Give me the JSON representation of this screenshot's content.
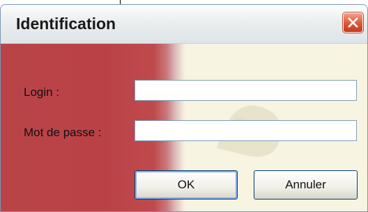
{
  "window": {
    "title": "Identification"
  },
  "form": {
    "login_label": "Login :",
    "login_value": "",
    "password_label": "Mot de passe :",
    "password_value": ""
  },
  "buttons": {
    "ok_label": "OK",
    "cancel_label": "Annuler"
  },
  "icons": {
    "close": "close-icon"
  },
  "colors": {
    "side_panel": "#b94448",
    "close_button": "#de5638",
    "background": "#f7f4e2"
  }
}
